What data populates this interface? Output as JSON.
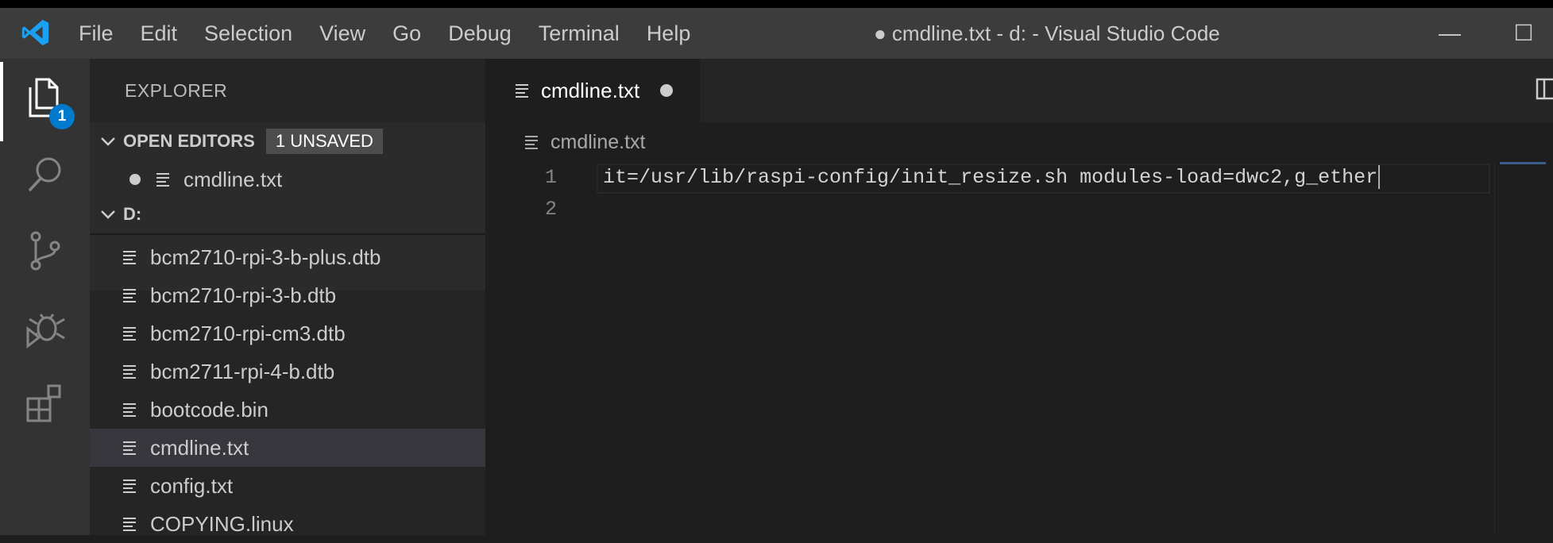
{
  "window": {
    "title": "● cmdline.txt - d: - Visual Studio Code",
    "minimize": "—",
    "maximize": "☐"
  },
  "menu": [
    "File",
    "Edit",
    "Selection",
    "View",
    "Go",
    "Debug",
    "Terminal",
    "Help"
  ],
  "activity_bar": {
    "explorer_badge": "1"
  },
  "sidebar": {
    "title": "EXPLORER",
    "open_editors": {
      "label": "OPEN EDITORS",
      "badge": "1 UNSAVED",
      "files": [
        "cmdline.txt"
      ]
    },
    "folder": {
      "label": "D:",
      "files": [
        "bcm2710-rpi-3-b-plus.dtb",
        "bcm2710-rpi-3-b.dtb",
        "bcm2710-rpi-cm3.dtb",
        "bcm2711-rpi-4-b.dtb",
        "bootcode.bin",
        "cmdline.txt",
        "config.txt",
        "COPYING.linux"
      ],
      "selected": "cmdline.txt"
    }
  },
  "editor": {
    "tab_label": "cmdline.txt",
    "breadcrumb": "cmdline.txt",
    "lines": [
      {
        "number": "1",
        "text": "it=/usr/lib/raspi-config/init_resize.sh modules-load=dwc2,g_ether"
      },
      {
        "number": "2",
        "text": ""
      }
    ]
  },
  "colors": {
    "accent": "#007acc",
    "titlebar": "#3c3c3c",
    "activitybar": "#333333",
    "sidebar": "#252526",
    "editor": "#1e1e1e"
  }
}
